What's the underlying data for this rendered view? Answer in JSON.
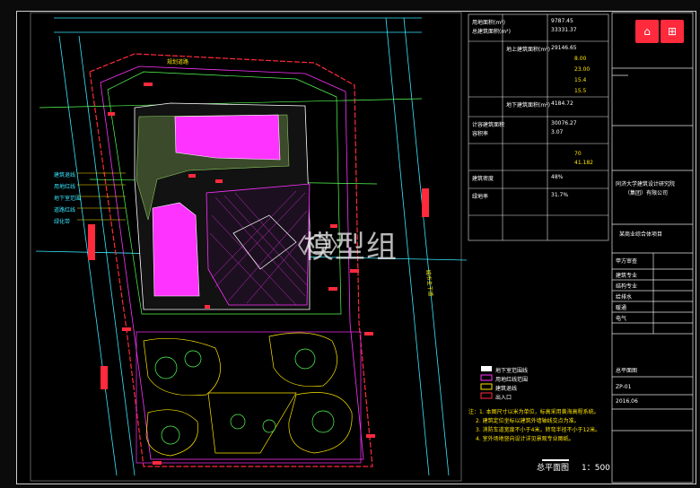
{
  "drawing": {
    "title": "总平面图",
    "scale": "1：500",
    "watermark": "模型组",
    "watermark_mark": "〈〇〉"
  },
  "site_table": {
    "rows": [
      {
        "label": "用地面积(m²)",
        "value": "9787.45"
      },
      {
        "label": "总建筑面积(m²)",
        "value": "33331.37"
      },
      {
        "label": "地上建筑面积(m²)",
        "value": "29146.65"
      },
      {
        "label": "地下建筑面积(m²)",
        "value": "4184.72"
      },
      {
        "label": "计容建筑面积",
        "value": "30076.27"
      },
      {
        "label": "容积率",
        "value": "3.07"
      },
      {
        "label": "建筑密度",
        "value": "48%"
      },
      {
        "label": "绿地率",
        "value": "31.7%"
      }
    ],
    "side_values": [
      "8.00",
      "23.00",
      "15.4",
      "15.5",
      "70",
      "41.182"
    ]
  },
  "legend": {
    "items": [
      "地下室范围线",
      "用地红线范围",
      "建筑退线",
      "出入口"
    ]
  },
  "institute": {
    "name": "同济大学建筑设计研究院",
    "name2": "（集团）有限公司",
    "project": "某商业综合体项目",
    "sheet_name": "总平面图",
    "drawing_no": "ZP-01",
    "date": "2016.06",
    "rev_rows": [
      "甲方审查",
      "建筑专业",
      "结构专业",
      "给排水",
      "暖通",
      "电气"
    ]
  },
  "left_labels": [
    "建筑退线",
    "用地红线",
    "地下室范围",
    "道路红线",
    "绿化带"
  ],
  "road_labels": [
    "规划道路",
    "城市主干道"
  ],
  "notes": [
    "注：1. 本图尺寸以米为单位，标高采用黄海高程系统。",
    "2. 建筑定位坐标以建筑外墙轴线交点为准。",
    "3. 消防车道宽度不小于4米，转弯半径不小于12米。",
    "4. 室外场地竖向设计详见景观专业图纸。"
  ],
  "colors": {
    "building_fill": "#ff33ff",
    "redline": "#ff2a3c",
    "road": "#39e6ff",
    "green_line": "#56ff56",
    "yellow_line": "#ffe400",
    "frame": "#e6e6e6"
  }
}
